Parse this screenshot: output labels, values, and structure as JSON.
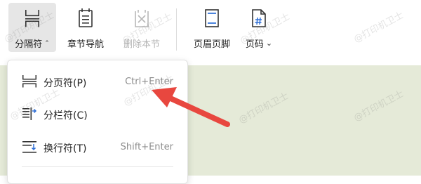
{
  "toolbar": {
    "buttons": [
      {
        "label": "分隔符",
        "icon": "separator-icon",
        "dropdown": true
      },
      {
        "label": "章节导航",
        "icon": "section-navigation-icon"
      },
      {
        "label": "删除本节",
        "icon": "delete-section-icon",
        "disabled": true
      },
      {
        "label": "页眉页脚",
        "icon": "header-footer-icon"
      },
      {
        "label": "页码",
        "icon": "page-number-icon",
        "dropdown": true
      }
    ],
    "caret_symbol": "⌃",
    "dropdown_symbol": "⌄"
  },
  "menu": {
    "items": [
      {
        "label": "分页符(P)",
        "shortcut": "Ctrl+Enter",
        "icon": "page-break-icon"
      },
      {
        "label": "分栏符(C)",
        "shortcut": "",
        "icon": "column-break-icon"
      },
      {
        "label": "换行符(T)",
        "shortcut": "Shift+Enter",
        "icon": "line-break-icon"
      }
    ]
  },
  "watermark": {
    "text": "@打印机卫士"
  },
  "colors": {
    "annotation_arrow": "#e8473f",
    "document_background": "#e5ead8",
    "icon_blue": "#2f6fd6"
  }
}
